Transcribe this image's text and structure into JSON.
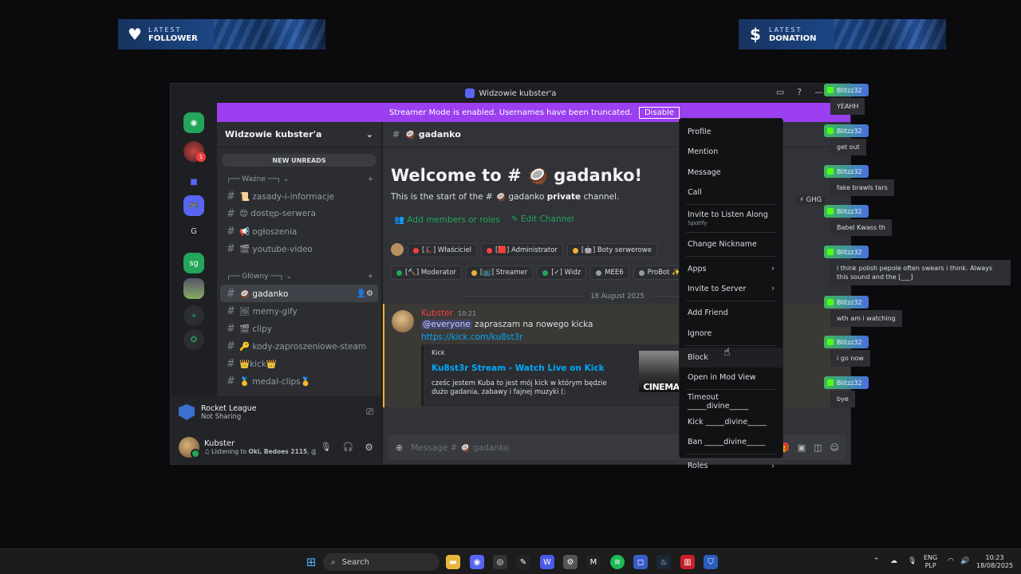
{
  "overlay": {
    "follower": {
      "line1": "LATEST",
      "line2": "FOLLOWER"
    },
    "donation": {
      "line1": "LATEST",
      "line2": "DONATION"
    }
  },
  "window": {
    "title": "Widzowie kubster'a"
  },
  "streamer_mode": {
    "text": "Streamer Mode is enabled. Usernames have been truncated.",
    "button": "Disable"
  },
  "servers": {
    "label_g": "G",
    "label_sg": "sg",
    "badge": "1"
  },
  "guild": {
    "name": "Widzowie kubster'a",
    "new_unreads": "NEW UNREADS",
    "categories": [
      {
        "label": "Ważne",
        "channels": [
          "📜 zasady-i-informacje",
          "😍 dostęp-serwera",
          "📢 ogłoszenia",
          "🎬 youtube-video"
        ]
      },
      {
        "label": "Główny",
        "channels": [
          "🥥 gadanko",
          "🖼 memy-gify",
          "🎬 clipy",
          "🔑 kody-zaproszeniowe-steam",
          "👑kick👑",
          "🥇 medal-clips🥇"
        ]
      }
    ]
  },
  "activity": {
    "title": "Rocket League",
    "sub": "Not Sharing"
  },
  "user": {
    "name": "Kubster",
    "status_prefix": "Listening to ",
    "status_bold": "Oki, Bedoes 2115",
    "status_suffix": ", @a..."
  },
  "chat": {
    "channel": "🥥 gadanko",
    "welcome": "Welcome to # 🥥 gadanko!",
    "welcome_sub_prefix": "This is the start of the # 🥥 gadanko ",
    "welcome_sub_bold": "private",
    "welcome_sub_suffix": " channel.",
    "add_members": "Add members or roles",
    "edit_channel": "Edit Channel",
    "roles_row1": [
      {
        "label": "[🎩] Właściciel",
        "color": "#f23f43"
      },
      {
        "label": "[🟥] Administrator",
        "color": "#f23f43"
      },
      {
        "label": "[🤖] Boty serwerowe",
        "color": "#f0b232"
      }
    ],
    "roles_row2": [
      {
        "label": "[🔨] Moderator",
        "color": "#23a55a"
      },
      {
        "label": "[📺] Streamer",
        "color": "#f0b232"
      },
      {
        "label": "[✓] Widz",
        "color": "#23a55a"
      },
      {
        "label": "MEE6",
        "color": "#949ba4"
      },
      {
        "label": "ProBot ✨",
        "color": "#949ba4"
      }
    ],
    "date": "18 August 2025",
    "message": {
      "author": "Kubster",
      "time": "10:21",
      "mention": "@everyone",
      "text": " zapraszam na nowego kicka",
      "link": "https://kick.com/ku8st3r",
      "embed_provider": "Kick",
      "embed_title": "Ku8st3r Stream - Watch Live on Kick",
      "embed_desc": "cześc jestem Kuba to jest mój kick w którym będzie dużo gadania, zabawy i fajnej muzyki (:",
      "thumb_text": "CINEMA"
    },
    "composer_placeholder": "Message # 🥥 gadanko",
    "ghg": "GHG"
  },
  "context_menu": [
    {
      "label": "Profile"
    },
    {
      "label": "Mention"
    },
    {
      "label": "Message"
    },
    {
      "label": "Call"
    },
    {
      "label": "Invite to Listen Along",
      "sub": "Spotify"
    },
    {
      "label": "Change Nickname"
    },
    {
      "label": "Apps",
      "arrow": true
    },
    {
      "label": "Invite to Server",
      "arrow": true
    },
    {
      "label": "Add Friend"
    },
    {
      "label": "Ignore"
    },
    {
      "label": "Block"
    },
    {
      "label": "Open in Mod View"
    },
    {
      "label": "Timeout _____divine_____"
    },
    {
      "label": "Kick _____divine_____"
    },
    {
      "label": "Ban _____divine_____"
    },
    {
      "label": "Roles",
      "arrow": true
    }
  ],
  "feed": [
    {
      "name": "Blitzz32",
      "msg": "YEAHH"
    },
    {
      "name": "Blitzz32",
      "msg": "get out"
    },
    {
      "name": "Blitzz32",
      "msg": "fake brawls tars"
    },
    {
      "name": "Blitzz32",
      "msg": "Babel Kwass th"
    },
    {
      "name": "Blitzz32",
      "msg": "i think polish pepole often swears i think. Always this sound and the [___]"
    },
    {
      "name": "Blitzz32",
      "msg": "wth am i watching"
    },
    {
      "name": "Blitzz32",
      "msg": "i go now"
    },
    {
      "name": "Blitzz32",
      "msg": "bye"
    }
  ],
  "taskbar": {
    "search": "Search",
    "lang1": "ENG",
    "lang2": "PLP",
    "time": "10:23",
    "date": "18/08/2025"
  }
}
